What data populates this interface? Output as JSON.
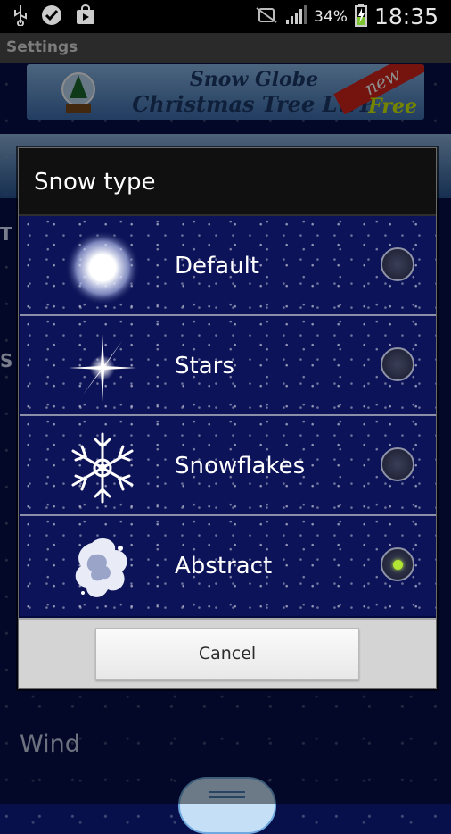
{
  "status_bar": {
    "battery_percent": "34%",
    "time": "18:35",
    "icons": [
      "usb-icon",
      "check-icon",
      "store-bag-icon",
      "mute-icon",
      "signal-icon",
      "battery-charging-icon"
    ]
  },
  "settings_header": {
    "title": "Settings"
  },
  "background": {
    "banner_top": {
      "line1": "Snow Globe",
      "line2": "Christmas Tree LWP",
      "ribbon": "new",
      "badge": "Free"
    },
    "row_initial_1": "T",
    "row_initial_2": "S",
    "wind_label": "Wind"
  },
  "dialog": {
    "title": "Snow type",
    "options": [
      {
        "label": "Default",
        "icon": "glow-orb-icon",
        "selected": false
      },
      {
        "label": "Stars",
        "icon": "sparkle-star-icon",
        "selected": false
      },
      {
        "label": "Snowflakes",
        "icon": "snowflake-icon",
        "selected": false
      },
      {
        "label": "Abstract",
        "icon": "abstract-cloud-icon",
        "selected": true
      }
    ],
    "cancel_label": "Cancel"
  },
  "colors": {
    "selected_radio": "#b2e533",
    "sky": "#0c1358"
  }
}
